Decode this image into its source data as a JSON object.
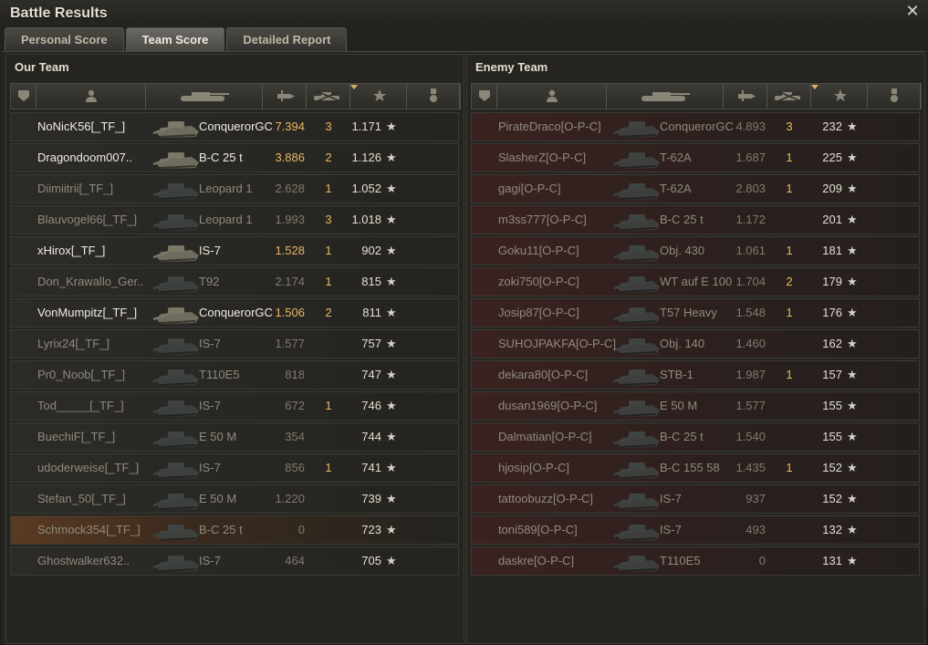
{
  "window": {
    "title": "Battle Results",
    "close_glyph": "✕"
  },
  "tabs": [
    {
      "label": "Personal Score",
      "active": false
    },
    {
      "label": "Team Score",
      "active": true
    },
    {
      "label": "Detailed Report",
      "active": false
    }
  ],
  "columns": [
    "platoon",
    "player",
    "vehicle",
    "damage",
    "kills",
    "experience",
    "medals"
  ],
  "our_team": {
    "title": "Our Team",
    "rows": [
      {
        "player": "NoNicK56[_TF_]",
        "tank": "ConquerorGC",
        "damage": "7.394",
        "kills": "3",
        "xp": "1.171",
        "alive": true
      },
      {
        "player": "Dragondoom007..",
        "tank": "B-C 25 t",
        "damage": "3.886",
        "kills": "2",
        "xp": "1.126",
        "alive": true
      },
      {
        "player": "Diimiitrii[_TF_]",
        "tank": "Leopard 1",
        "damage": "2.628",
        "kills": "1",
        "xp": "1.052",
        "alive": false
      },
      {
        "player": "Blauvogel66[_TF_]",
        "tank": "Leopard 1",
        "damage": "1.993",
        "kills": "3",
        "xp": "1.018",
        "alive": false
      },
      {
        "player": "xHirox[_TF_]",
        "tank": "IS-7",
        "damage": "1.528",
        "kills": "1",
        "xp": "902",
        "alive": true
      },
      {
        "player": "Don_Krawallo_Ger..",
        "tank": "T92",
        "damage": "2.174",
        "kills": "1",
        "xp": "815",
        "alive": false
      },
      {
        "player": "VonMumpitz[_TF_]",
        "tank": "ConquerorGC",
        "damage": "1.506",
        "kills": "2",
        "xp": "811",
        "alive": true
      },
      {
        "player": "Lyrix24[_TF_]",
        "tank": "IS-7",
        "damage": "1.577",
        "kills": "",
        "xp": "757",
        "alive": false
      },
      {
        "player": "Pr0_Noob[_TF_]",
        "tank": "T110E5",
        "damage": "818",
        "kills": "",
        "xp": "747",
        "alive": false
      },
      {
        "player": "Tod_____[_TF_]",
        "tank": "IS-7",
        "damage": "672",
        "kills": "1",
        "xp": "746",
        "alive": false
      },
      {
        "player": "BuechiF[_TF_]",
        "tank": "E 50 M",
        "damage": "354",
        "kills": "",
        "xp": "744",
        "alive": false
      },
      {
        "player": "udoderweise[_TF_]",
        "tank": "IS-7",
        "damage": "856",
        "kills": "1",
        "xp": "741",
        "alive": false
      },
      {
        "player": "Stefan_50[_TF_]",
        "tank": "E 50 M",
        "damage": "1.220",
        "kills": "",
        "xp": "739",
        "alive": false
      },
      {
        "player": "Schmock354[_TF_]",
        "tank": "B-C 25 t",
        "damage": "0",
        "kills": "",
        "xp": "723",
        "alive": false,
        "self": true
      },
      {
        "player": "Ghostwalker632..",
        "tank": "IS-7",
        "damage": "464",
        "kills": "",
        "xp": "705",
        "alive": false
      }
    ]
  },
  "enemy_team": {
    "title": "Enemy Team",
    "rows": [
      {
        "player": "PirateDraco[O-P-C]",
        "tank": "ConquerorGC",
        "damage": "4.893",
        "kills": "3",
        "xp": "232"
      },
      {
        "player": "SlasherZ[O-P-C]",
        "tank": "T-62A",
        "damage": "1.687",
        "kills": "1",
        "xp": "225"
      },
      {
        "player": "gagi[O-P-C]",
        "tank": "T-62A",
        "damage": "2.803",
        "kills": "1",
        "xp": "209"
      },
      {
        "player": "m3ss777[O-P-C]",
        "tank": "B-C 25 t",
        "damage": "1.172",
        "kills": "",
        "xp": "201"
      },
      {
        "player": "Goku11[O-P-C]",
        "tank": "Obj. 430",
        "damage": "1.061",
        "kills": "1",
        "xp": "181"
      },
      {
        "player": "zoki750[O-P-C]",
        "tank": "WT auf E 100",
        "damage": "1.704",
        "kills": "2",
        "xp": "179"
      },
      {
        "player": "Josip87[O-P-C]",
        "tank": "T57 Heavy",
        "damage": "1.548",
        "kills": "1",
        "xp": "176"
      },
      {
        "player": "SUHOJPAKFA[O-P-C]",
        "tank": "Obj. 140",
        "damage": "1.460",
        "kills": "",
        "xp": "162"
      },
      {
        "player": "dekara80[O-P-C]",
        "tank": "STB-1",
        "damage": "1.987",
        "kills": "1",
        "xp": "157"
      },
      {
        "player": "dusan1969[O-P-C]",
        "tank": "E 50 M",
        "damage": "1.577",
        "kills": "",
        "xp": "155"
      },
      {
        "player": "Dalmatian[O-P-C]",
        "tank": "B-C 25 t",
        "damage": "1.540",
        "kills": "",
        "xp": "155"
      },
      {
        "player": "hjosip[O-P-C]",
        "tank": "B-C 155 58",
        "damage": "1.435",
        "kills": "1",
        "xp": "152"
      },
      {
        "player": "tattoobuzz[O-P-C]",
        "tank": "IS-7",
        "damage": "937",
        "kills": "",
        "xp": "152"
      },
      {
        "player": "toni589[O-P-C]",
        "tank": "IS-7",
        "damage": "493",
        "kills": "",
        "xp": "132"
      },
      {
        "player": "daskre[O-P-C]",
        "tank": "T110E5",
        "damage": "0",
        "kills": "",
        "xp": "131"
      }
    ]
  },
  "icons": {
    "star": "★",
    "platoon": "shield-icon",
    "player": "person-icon",
    "vehicle": "tank-icon",
    "damage": "shell-icon",
    "kills": "destroyed-tank-icon",
    "xp": "star-icon",
    "medal": "medal-icon"
  }
}
